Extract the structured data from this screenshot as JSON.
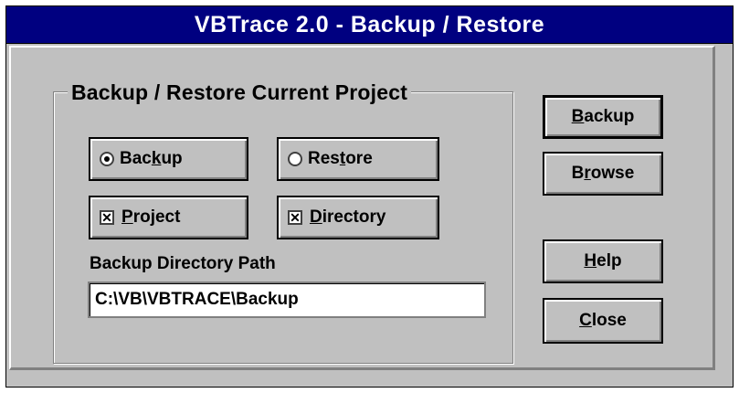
{
  "window": {
    "title": "VBTrace 2.0  -  Backup / Restore"
  },
  "group": {
    "title": "Backup / Restore Current Project",
    "mode_options": [
      {
        "pre": "Bac",
        "u": "k",
        "post": "up",
        "selected": true
      },
      {
        "pre": "Res",
        "u": "t",
        "post": "ore",
        "selected": false
      }
    ],
    "include_options": [
      {
        "pre": "",
        "u": "P",
        "post": "roject",
        "checked": true
      },
      {
        "pre": "",
        "u": "D",
        "post": "irectory",
        "checked": true
      }
    ],
    "path_label": "Backup Directory Path",
    "path_value": "C:\\VB\\VBTRACE\\Backup"
  },
  "buttons": {
    "backup": {
      "u": "B",
      "rest": "ackup"
    },
    "browse": {
      "pre": "B",
      "u": "r",
      "rest": "owse"
    },
    "help": {
      "u": "H",
      "rest": "elp"
    },
    "close": {
      "u": "C",
      "rest": "lose"
    }
  },
  "check_glyph": "✕"
}
